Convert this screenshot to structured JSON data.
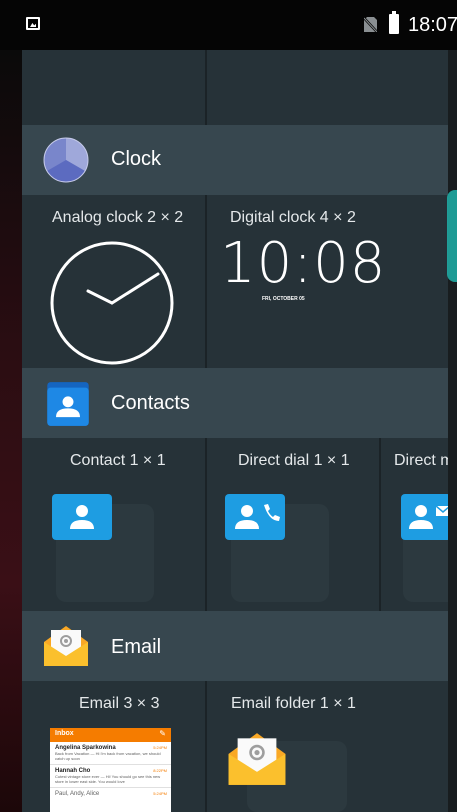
{
  "status_bar": {
    "time": "18:07"
  },
  "sections": {
    "clock": {
      "title": "Clock",
      "widgets": [
        {
          "label": "Analog clock  2 × 2"
        },
        {
          "label": "Digital clock  4 × 2",
          "time": "10:08",
          "date": "FRI, OCTOBER 05"
        }
      ]
    },
    "contacts": {
      "title": "Contacts",
      "widgets": [
        {
          "label": "Contact  1 × 1"
        },
        {
          "label": "Direct dial  1 × 1"
        },
        {
          "label": "Direct me"
        }
      ]
    },
    "email": {
      "title": "Email",
      "widgets": [
        {
          "label": "Email  3 × 3",
          "preview": {
            "inbox_label": "Inbox",
            "messages": [
              {
                "sender": "Angelina Sparkowina",
                "line": "Back from Vacation — Hi I'm back from vacation, we should catch up soon",
                "time": "5:24PM"
              },
              {
                "sender": "Hannah Cho",
                "line": "Cutest vintage store ever — Hi! You should go see this new store in lower east side. You would love",
                "time": "8:22PM"
              },
              {
                "sender": "Paul, Andy, Alice",
                "line": "",
                "time": "5:24PM"
              }
            ]
          }
        },
        {
          "label": "Email folder  1 × 1"
        }
      ]
    }
  },
  "colors": {
    "accent_teal": "#20b2aa",
    "contact_blue": "#1e9de2",
    "email_yellow": "#fbc02d"
  }
}
